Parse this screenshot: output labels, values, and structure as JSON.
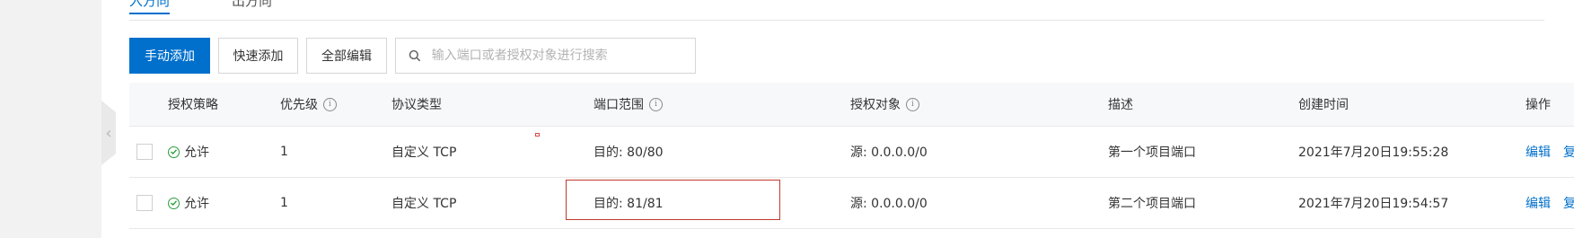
{
  "tabs": [
    {
      "label": "入方向",
      "active": true
    },
    {
      "label": "出方向",
      "active": false
    }
  ],
  "toolbar": {
    "manual_add": "手动添加",
    "quick_add": "快速添加",
    "edit_all": "全部编辑"
  },
  "search": {
    "placeholder": "输入端口或者授权对象进行搜索",
    "value": ""
  },
  "table": {
    "headers": {
      "policy": "授权策略",
      "priority": "优先级",
      "protocol": "协议类型",
      "port_range": "端口范围",
      "auth_object": "授权对象",
      "description": "描述",
      "created": "创建时间",
      "actions": "操作"
    },
    "rows": [
      {
        "policy": "允许",
        "priority": "1",
        "protocol": "自定义 TCP",
        "port_range": "目的: 80/80",
        "auth_object": "源: 0.0.0.0/0",
        "description": "第一个项目端口",
        "created": "2021年7月20日19:55:28",
        "edit": "编辑",
        "more": "复"
      },
      {
        "policy": "允许",
        "priority": "1",
        "protocol": "自定义 TCP",
        "port_range": "目的: 81/81",
        "auth_object": "源: 0.0.0.0/0",
        "description": "第二个项目端口",
        "created": "2021年7月20日19:54:57",
        "edit": "编辑",
        "more": "复"
      }
    ]
  },
  "colors": {
    "primary": "#0070cc",
    "allow_green": "#2a9d3b",
    "highlight_red": "#c0392b"
  }
}
